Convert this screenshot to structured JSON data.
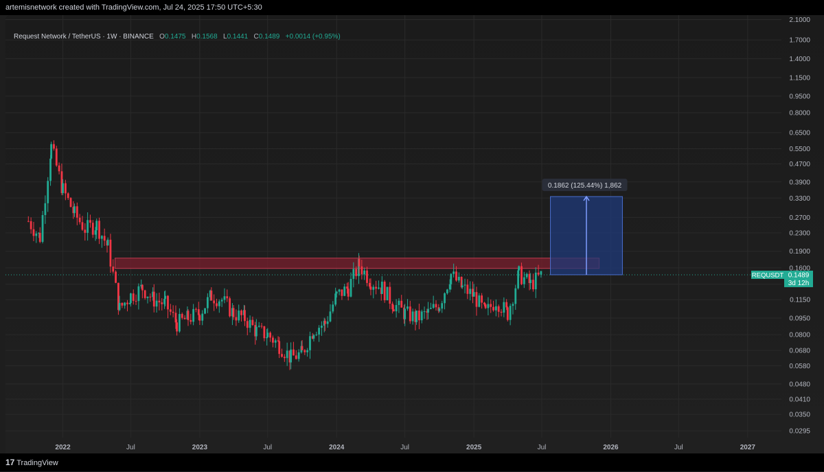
{
  "header": {
    "attribution": "artemisnetwork created with TradingView.com, Jul 24, 2025 17:50 UTC+5:30"
  },
  "legend": {
    "symbol": "Request Network / TetherUS · 1W · BINANCE",
    "open_key": "O",
    "open": "0.1475",
    "high_key": "H",
    "high": "0.1568",
    "low_key": "L",
    "low": "0.1441",
    "close_key": "C",
    "close": "0.1489",
    "change": "+0.0014 (+0.95%)"
  },
  "footer": {
    "brand": "TradingView",
    "logo_glyph": "17"
  },
  "colors": {
    "up": "#22ab94",
    "down": "#f23645",
    "zone_fill": "#7a1f2e",
    "zone_border": "#c03a4e",
    "measure_fill": "#1f3a7a",
    "measure_border": "#4a6fd0",
    "price_tag": "#22ab94",
    "grid": "#2a2a2a",
    "text": "#b2b5be"
  },
  "chart_data": {
    "type": "candlestick",
    "scale": "log",
    "y_axis_ticks": [
      "2.1000",
      "1.7000",
      "1.4000",
      "1.1500",
      "0.9500",
      "0.8000",
      "0.6500",
      "0.5500",
      "0.4700",
      "0.3900",
      "0.3300",
      "0.2700",
      "0.2300",
      "0.1900",
      "0.1600",
      "0.1350",
      "0.1150",
      "0.0950",
      "0.0800",
      "0.0680",
      "0.0580",
      "0.0480",
      "0.0410",
      "0.0350",
      "0.0295"
    ],
    "x_axis_ticks": [
      "2022",
      "Jul",
      "2023",
      "Jul",
      "2024",
      "Jul",
      "2025",
      "Jul",
      "2026",
      "Jul",
      "2027"
    ],
    "x_axis_tick_dates": [
      "2022-01-01",
      "2022-07-01",
      "2023-01-01",
      "2023-07-01",
      "2024-01-01",
      "2024-07-01",
      "2025-01-01",
      "2025-07-01",
      "2026-01-01",
      "2026-07-01",
      "2027-01-01"
    ],
    "x_range": [
      "2021-08-01",
      "2027-04-01"
    ],
    "y_range": [
      0.0275,
      2.2
    ],
    "grid": true,
    "price_label": {
      "symbol": "REQUSDT",
      "value": "0.1489",
      "countdown": "3d 12h"
    },
    "last_price": 0.1489,
    "resistance_zone": {
      "from": "2022-05-20",
      "to": "2025-12-01",
      "low": 0.159,
      "high": 0.177
    },
    "measure": {
      "from": "2025-07-24",
      "to": "2026-02-01",
      "base": 0.1489,
      "top": 0.3351,
      "label": "0.1862 (125.44%) 1,862"
    },
    "series": [
      {
        "date": "2021-10-01",
        "close": 0.26
      },
      {
        "date": "2021-11-01",
        "close": 0.22
      },
      {
        "date": "2021-12-01",
        "close": 0.56
      },
      {
        "date": "2022-01-01",
        "close": 0.36
      },
      {
        "date": "2022-02-01",
        "close": 0.28
      },
      {
        "date": "2022-03-01",
        "close": 0.24
      },
      {
        "date": "2022-04-01",
        "close": 0.25
      },
      {
        "date": "2022-05-01",
        "close": 0.2
      },
      {
        "date": "2022-06-01",
        "close": 0.105
      },
      {
        "date": "2022-07-01",
        "close": 0.12
      },
      {
        "date": "2022-08-01",
        "close": 0.13
      },
      {
        "date": "2022-09-01",
        "close": 0.115
      },
      {
        "date": "2022-10-01",
        "close": 0.11
      },
      {
        "date": "2022-11-01",
        "close": 0.09
      },
      {
        "date": "2022-12-01",
        "close": 0.095
      },
      {
        "date": "2023-01-01",
        "close": 0.1
      },
      {
        "date": "2023-02-01",
        "close": 0.12
      },
      {
        "date": "2023-03-01",
        "close": 0.115
      },
      {
        "date": "2023-04-01",
        "close": 0.1
      },
      {
        "date": "2023-05-01",
        "close": 0.095
      },
      {
        "date": "2023-06-01",
        "close": 0.083
      },
      {
        "date": "2023-07-01",
        "close": 0.08
      },
      {
        "date": "2023-08-01",
        "close": 0.072
      },
      {
        "date": "2023-09-01",
        "close": 0.063
      },
      {
        "date": "2023-10-01",
        "close": 0.066
      },
      {
        "date": "2023-11-01",
        "close": 0.085
      },
      {
        "date": "2023-12-01",
        "close": 0.09
      },
      {
        "date": "2024-01-01",
        "close": 0.12
      },
      {
        "date": "2024-02-01",
        "close": 0.13
      },
      {
        "date": "2024-03-01",
        "close": 0.165
      },
      {
        "date": "2024-04-01",
        "close": 0.14
      },
      {
        "date": "2024-05-01",
        "close": 0.13
      },
      {
        "date": "2024-06-01",
        "close": 0.11
      },
      {
        "date": "2024-07-01",
        "close": 0.1
      },
      {
        "date": "2024-08-01",
        "close": 0.095
      },
      {
        "date": "2024-09-01",
        "close": 0.1
      },
      {
        "date": "2024-10-01",
        "close": 0.11
      },
      {
        "date": "2024-11-01",
        "close": 0.15
      },
      {
        "date": "2024-12-01",
        "close": 0.13
      },
      {
        "date": "2025-01-01",
        "close": 0.12
      },
      {
        "date": "2025-02-01",
        "close": 0.1
      },
      {
        "date": "2025-03-01",
        "close": 0.115
      },
      {
        "date": "2025-04-01",
        "close": 0.1
      },
      {
        "date": "2025-05-01",
        "close": 0.15
      },
      {
        "date": "2025-06-01",
        "close": 0.135
      },
      {
        "date": "2025-07-01",
        "close": 0.1489
      }
    ]
  }
}
